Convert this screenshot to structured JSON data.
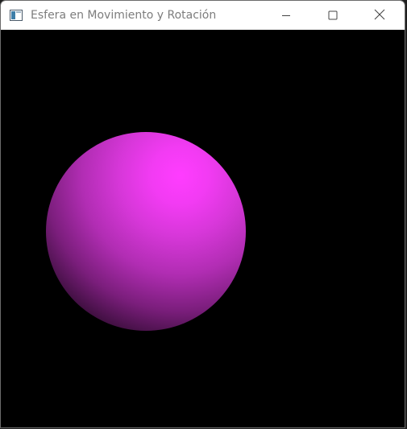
{
  "window": {
    "title": "Esfera en Movimiento y Rotación",
    "icon": "app-window-icon"
  },
  "titlebar_controls": {
    "minimize_icon": "minimize-icon",
    "maximize_icon": "maximize-icon",
    "close_icon": "close-icon"
  },
  "scene": {
    "background_color": "#000000",
    "sphere_color": "#ff3cff",
    "sphere_shadow_color": "#111111"
  }
}
